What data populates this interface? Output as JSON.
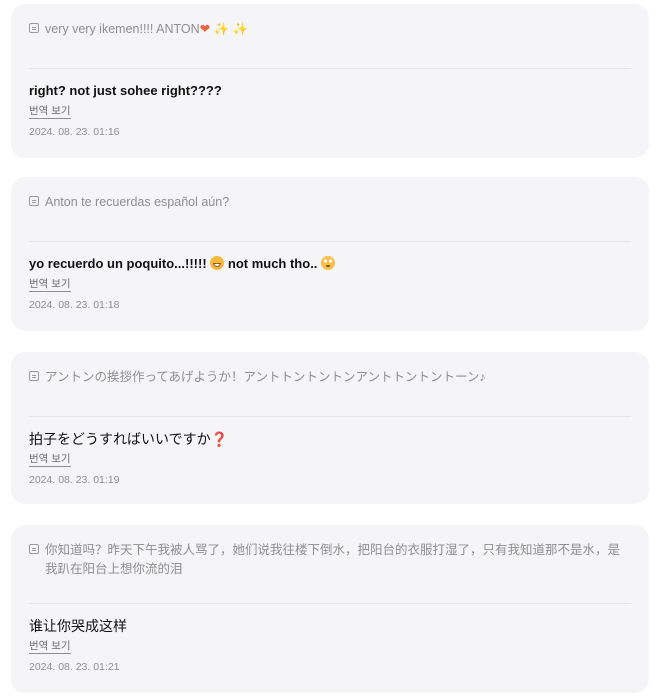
{
  "comments": [
    {
      "quote": "very very ikemen!!!! ANTON",
      "quote_suffix_heart": "❤",
      "quote_suffix_sparkles": "✨ ✨",
      "reply": "right? not just sohee right????",
      "translate_label": "번역 보기",
      "timestamp": "2024. 08. 23. 01:16"
    },
    {
      "quote": "Anton te recuerdas español aún?",
      "reply_part1": "yo recuerdo un poquito...!!!!! ",
      "reply_part2": " not much tho.. ",
      "translate_label": "번역 보기",
      "timestamp": "2024. 08. 23. 01:18"
    },
    {
      "quote": "アントンの挨拶作ってあげようか！アントトントントンアントトントントーン♪",
      "reply": "拍子をどうすればいいですか",
      "reply_mark": "❓",
      "translate_label": "번역 보기",
      "timestamp": "2024. 08. 23. 01:19"
    },
    {
      "quote": "你知道吗？昨天下午我被人骂了，她们说我往楼下倒水，把阳台的衣服打湿了，只有我知道那不是水，是我趴在阳台上想你流的泪",
      "reply": "谁让你哭成这样",
      "translate_label": "번역 보기",
      "timestamp": "2024. 08. 23. 01:21"
    }
  ],
  "colors": {
    "card_background": "#f5f5f7",
    "muted_text": "#8e8e93",
    "primary_text": "#111111"
  }
}
